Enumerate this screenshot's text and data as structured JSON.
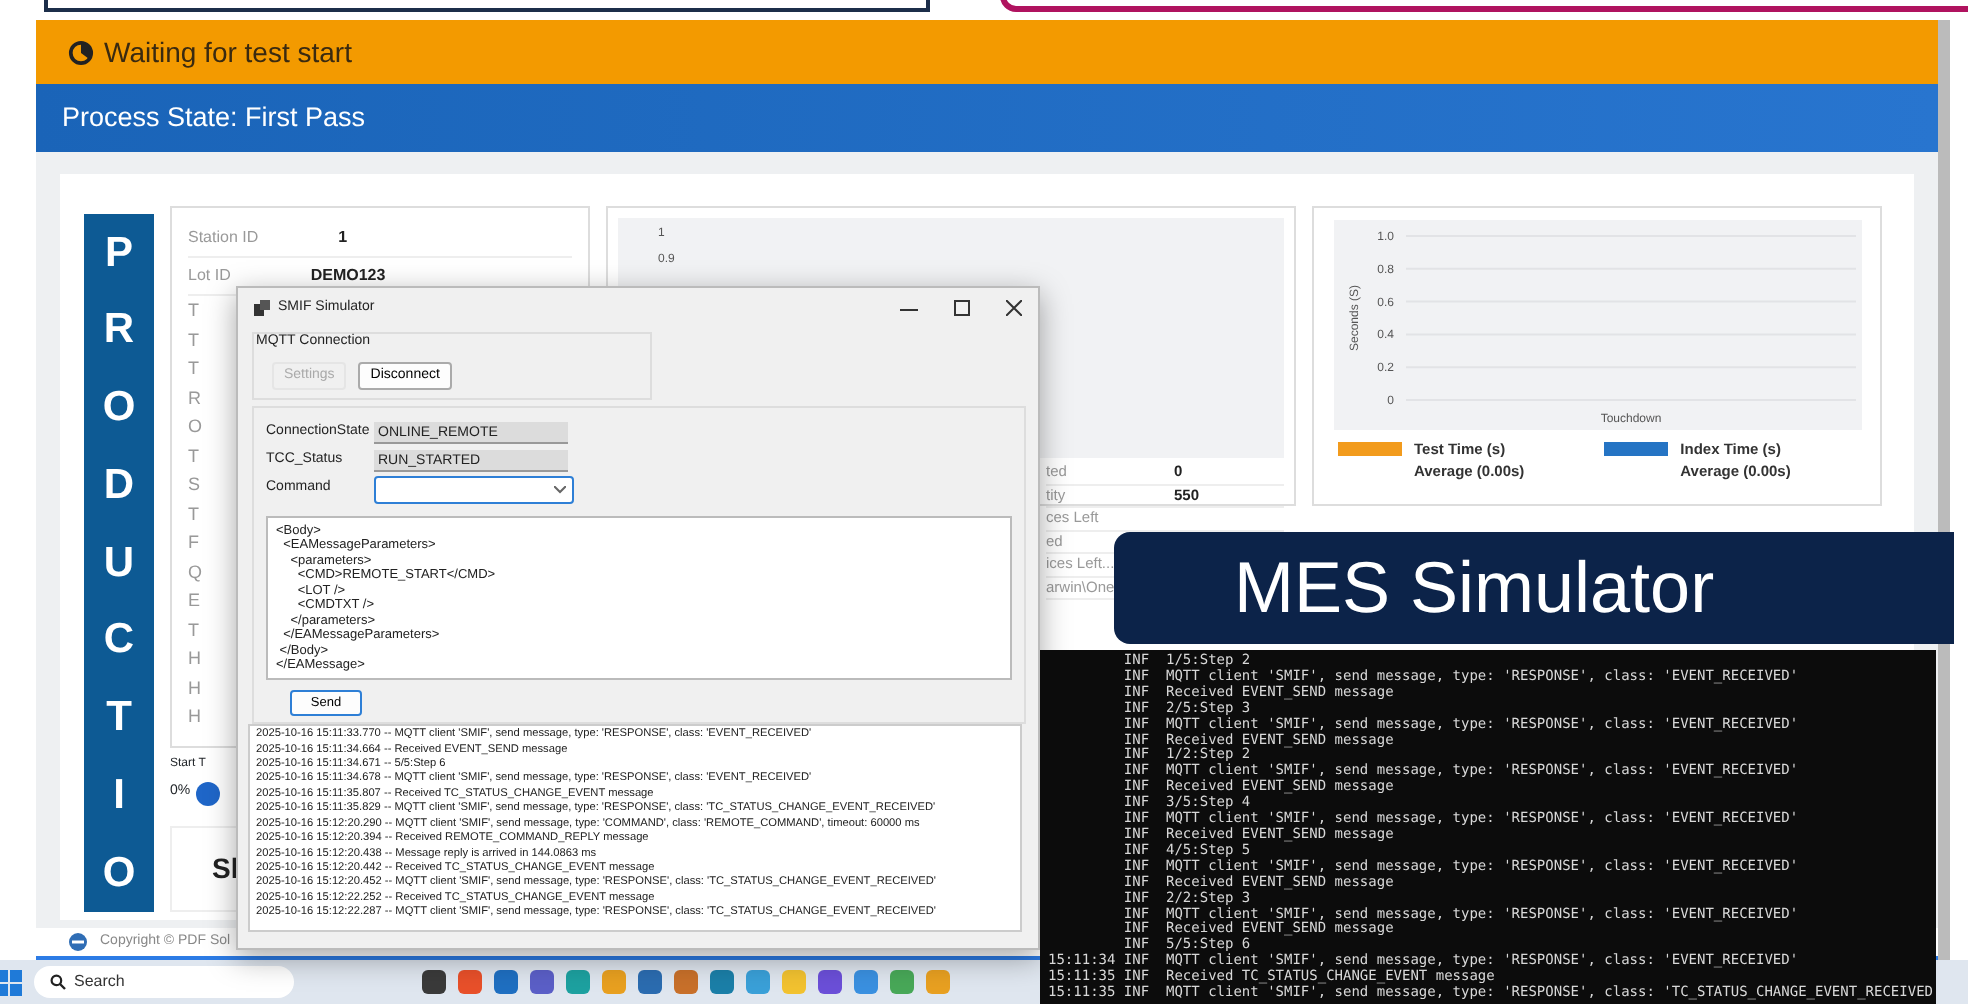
{
  "status_bar": {
    "text": "Waiting for test start"
  },
  "process_bar": {
    "text": "Process State: First Pass"
  },
  "banner_letters": [
    "P",
    "R",
    "O",
    "D",
    "U",
    "C",
    "T",
    "I",
    "O"
  ],
  "station_card": {
    "rows": [
      {
        "label": "Station ID",
        "value": "1"
      },
      {
        "label": "Lot ID",
        "value": "DEMO123"
      }
    ],
    "cut_labels": [
      "T",
      "T",
      "T",
      "R",
      "O",
      "T",
      "S",
      "T",
      "F",
      "Q",
      "E",
      "T",
      "H",
      "H",
      "H"
    ]
  },
  "start_label": "Start T",
  "progress_text": "0%",
  "bottom_card_text": "Sl",
  "middle_card": {
    "chart_ticks": [
      "1",
      "0.9"
    ],
    "rows": [
      {
        "label": "ted",
        "value": "0"
      },
      {
        "label": "tity",
        "value": "550"
      },
      {
        "label": "ces Left"
      },
      {
        "label": "ed"
      },
      {
        "label": "ices Left..."
      },
      {
        "label": "arwin\\One"
      }
    ]
  },
  "time_chart": {
    "chart_data": {
      "type": "bar",
      "ylabel": "Seconds (S)",
      "categories": [
        "Touchdown"
      ],
      "series": [
        {
          "name": "Test Time (s)",
          "color": "#f29b1d",
          "values": [
            0
          ]
        },
        {
          "name": "Index Time (s)",
          "color": "#2574c4",
          "values": [
            0
          ]
        }
      ],
      "ylim": [
        0,
        1
      ],
      "grid": true,
      "yticks": [
        0,
        0.2,
        0.4,
        0.6,
        0.8,
        {
          "value": 1,
          "label": "1.0"
        }
      ]
    },
    "legend_averages": [
      "Average (0.00s)",
      "Average (0.00s)"
    ]
  },
  "overlay_caption": "MES Simulator",
  "footer": "Copyright © PDF Sol",
  "dialog": {
    "title": "SMIF Simulator",
    "group_title": "MQTT Connection",
    "buttons": [
      {
        "label": "Settings",
        "disabled": true
      },
      {
        "label": "Disconnect",
        "disabled": false
      }
    ],
    "fields": [
      {
        "label": "ConnectionState",
        "value": "ONLINE_REMOTE",
        "kind": "text"
      },
      {
        "label": "TCC_Status",
        "value": "RUN_STARTED",
        "kind": "text"
      },
      {
        "label": "Command",
        "kind": "select"
      }
    ],
    "xml_lines": [
      "<Body>",
      "  <EAMessageParameters>",
      "    <parameters>",
      "      <CMD>REMOTE_START</CMD>",
      "      <LOT />",
      "      <CMDTXT />",
      "    </parameters>",
      "  </EAMessageParameters>",
      " </Body>",
      "</EAMessage>"
    ],
    "send_label": "Send",
    "log": [
      {
        "time": "2025-10-16 15:11:33.770 --",
        "text": "MQTT client 'SMIF', send message, type: 'RESPONSE', class: 'EVENT_RECEIVED'"
      },
      {
        "time": "2025-10-16 15:11:34.664 --",
        "text": "Received EVENT_SEND message"
      },
      {
        "time": "2025-10-16 15:11:34.671 --",
        "text": "5/5:Step 6"
      },
      {
        "time": "2025-10-16 15:11:34.678 --",
        "text": "MQTT client 'SMIF', send message, type: 'RESPONSE', class: 'EVENT_RECEIVED'"
      },
      {
        "time": "2025-10-16 15:11:35.807 --",
        "text": "Received TC_STATUS_CHANGE_EVENT message"
      },
      {
        "time": "2025-10-16 15:11:35.829 --",
        "text": "MQTT client 'SMIF', send message, type: 'RESPONSE', class: 'TC_STATUS_CHANGE_EVENT_RECEIVED'"
      },
      {
        "time": "2025-10-16 15:12:20.290 --",
        "text": "MQTT client 'SMIF', send message, type: 'COMMAND', class: 'REMOTE_COMMAND', timeout: 60000 ms"
      },
      {
        "time": "2025-10-16 15:12:20.394 --",
        "text": "Received REMOTE_COMMAND_REPLY message"
      },
      {
        "time": "2025-10-16 15:12:20.438 --",
        "text": "Message reply is arrived in 144.0863 ms"
      },
      {
        "time": "2025-10-16 15:12:20.442 --",
        "text": "Received TC_STATUS_CHANGE_EVENT message"
      },
      {
        "time": "2025-10-16 15:12:20.452 --",
        "text": "MQTT client 'SMIF', send message, type: 'RESPONSE', class: 'TC_STATUS_CHANGE_EVENT_RECEIVED'"
      },
      {
        "time": "2025-10-16 15:12:22.252 --",
        "text": "Received TC_STATUS_CHANGE_EVENT message"
      },
      {
        "time": "2025-10-16 15:12:22.287 --",
        "text": "MQTT client 'SMIF', send message, type: 'RESPONSE', class: 'TC_STATUS_CHANGE_EVENT_RECEIVED'"
      }
    ]
  },
  "terminal": [
    {
      "level": "INF",
      "text": "1/5:Step 2"
    },
    {
      "level": "INF",
      "text": "MQTT client 'SMIF', send message, type: 'RESPONSE', class: 'EVENT_RECEIVED'"
    },
    {
      "level": "INF",
      "text": "Received EVENT_SEND message"
    },
    {
      "level": "INF",
      "text": "2/5:Step 3"
    },
    {
      "level": "INF",
      "text": "MQTT client 'SMIF', send message, type: 'RESPONSE', class: 'EVENT_RECEIVED'"
    },
    {
      "level": "INF",
      "text": "Received EVENT_SEND message"
    },
    {
      "level": "INF",
      "text": "1/2:Step 2"
    },
    {
      "level": "INF",
      "text": "MQTT client 'SMIF', send message, type: 'RESPONSE', class: 'EVENT_RECEIVED'"
    },
    {
      "level": "INF",
      "text": "Received EVENT_SEND message"
    },
    {
      "level": "INF",
      "text": "3/5:Step 4"
    },
    {
      "level": "INF",
      "text": "MQTT client 'SMIF', send message, type: 'RESPONSE', class: 'EVENT_RECEIVED'"
    },
    {
      "level": "INF",
      "text": "Received EVENT_SEND message"
    },
    {
      "level": "INF",
      "text": "4/5:Step 5"
    },
    {
      "level": "INF",
      "text": "MQTT client 'SMIF', send message, type: 'RESPONSE', class: 'EVENT_RECEIVED'"
    },
    {
      "level": "INF",
      "text": "Received EVENT_SEND message"
    },
    {
      "level": "INF",
      "text": "2/2:Step 3"
    },
    {
      "level": "INF",
      "text": "MQTT client 'SMIF', send message, type: 'RESPONSE', class: 'EVENT_RECEIVED'"
    },
    {
      "level": "INF",
      "text": "Received EVENT_SEND message"
    },
    {
      "level": "INF",
      "text": "5/5:Step 6"
    },
    {
      "time": "15:11:34",
      "level": "INF",
      "text": "MQTT client 'SMIF', send message, type: 'RESPONSE', class: 'EVENT_RECEIVED'"
    },
    {
      "time": "15:11:35",
      "level": "INF",
      "text": "Received TC_STATUS_CHANGE_EVENT message"
    },
    {
      "time": "15:11:35",
      "level": "INF",
      "text": "MQTT client 'SMIF', send message, type: 'RESPONSE', class: 'TC_STATUS_CHANGE_EVENT_RECEIVED'"
    }
  ],
  "taskbar": {
    "search": "Search",
    "apps": [
      {
        "color": "#3a3a3a"
      },
      {
        "color": "#e8502a"
      },
      {
        "color": "#1f6fc1"
      },
      {
        "color": "#5b5fc7"
      },
      {
        "color": "#1da1a0"
      },
      {
        "color": "#e8a020"
      },
      {
        "color": "#2b6cb0"
      },
      {
        "color": "#c8702a"
      },
      {
        "color": "#1b7fa8"
      },
      {
        "color": "#3aa0d8"
      },
      {
        "color": "#f2c230"
      },
      {
        "color": "#6b4fd8"
      },
      {
        "color": "#3a90e0"
      },
      {
        "color": "#48a858"
      },
      {
        "color": "#e8a021"
      }
    ]
  }
}
